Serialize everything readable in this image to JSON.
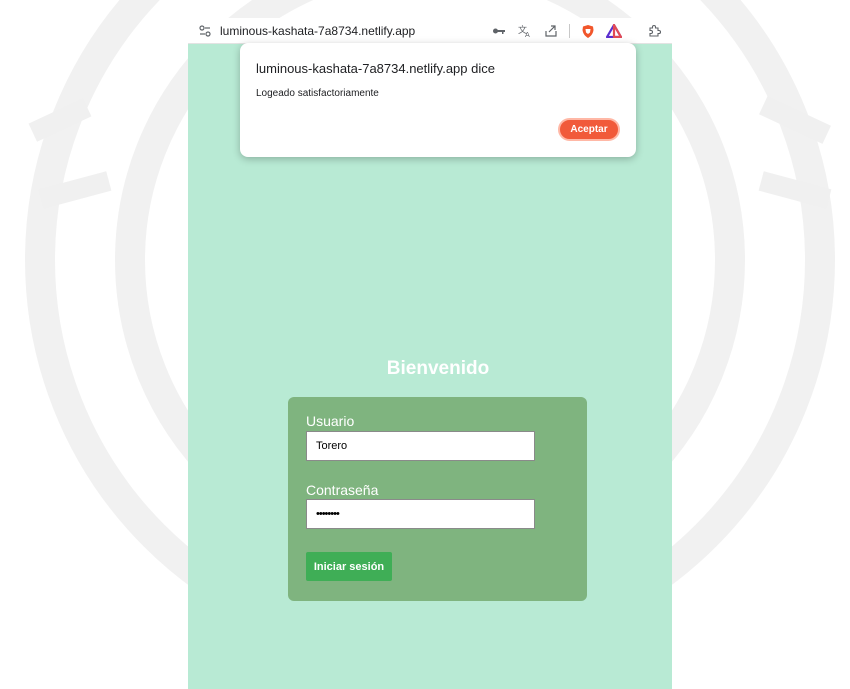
{
  "address_bar": {
    "url": "luminous-kashata-7a8734.netlify.app",
    "icons": [
      "site-info-icon",
      "key-icon",
      "translate-icon",
      "share-icon",
      "brave-shields-icon",
      "brave-rewards-icon",
      "extensions-icon"
    ]
  },
  "alert": {
    "title": "luminous-kashata-7a8734.netlify.app dice",
    "message": "Logeado satisfactoriamente",
    "ok_label": "Aceptar"
  },
  "login": {
    "welcome": "Bienvenido",
    "username_label": "Usuario",
    "username_value": "Torero",
    "password_label": "Contraseña",
    "password_value": "••••••••",
    "submit_label": "Iniciar sesión"
  },
  "colors": {
    "page_background": "#b8ead4",
    "card_background": "#7fb47f",
    "button_green": "#3fae56",
    "dialog_button": "#f15a3a"
  }
}
